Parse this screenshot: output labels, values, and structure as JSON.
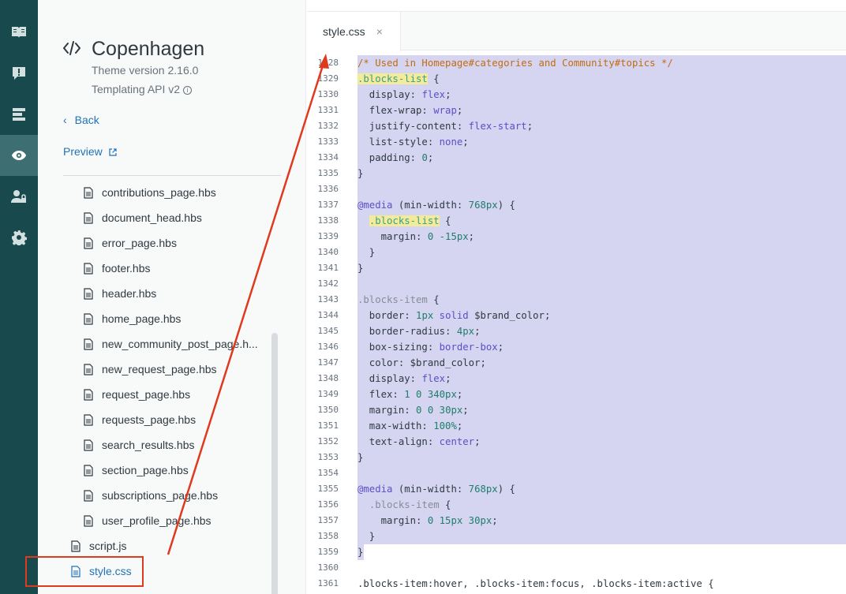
{
  "rail": {
    "items": [
      {
        "name": "guide-icon",
        "active": false
      },
      {
        "name": "alert-icon",
        "active": false
      },
      {
        "name": "layout-icon",
        "active": false
      },
      {
        "name": "eye-icon",
        "active": true
      },
      {
        "name": "user-lock-icon",
        "active": false
      },
      {
        "name": "gear-icon",
        "active": false
      }
    ]
  },
  "sidebar": {
    "theme_name": "Copenhagen",
    "theme_version": "Theme version 2.16.0",
    "api_version": "Templating API v2",
    "api_info": "i",
    "back_label": "Back",
    "preview_label": "Preview",
    "files": [
      {
        "label": "contributions_page.hbs",
        "level": "nested"
      },
      {
        "label": "document_head.hbs",
        "level": "nested"
      },
      {
        "label": "error_page.hbs",
        "level": "nested"
      },
      {
        "label": "footer.hbs",
        "level": "nested"
      },
      {
        "label": "header.hbs",
        "level": "nested"
      },
      {
        "label": "home_page.hbs",
        "level": "nested"
      },
      {
        "label": "new_community_post_page.h...",
        "level": "nested"
      },
      {
        "label": "new_request_page.hbs",
        "level": "nested"
      },
      {
        "label": "request_page.hbs",
        "level": "nested"
      },
      {
        "label": "requests_page.hbs",
        "level": "nested"
      },
      {
        "label": "search_results.hbs",
        "level": "nested"
      },
      {
        "label": "section_page.hbs",
        "level": "nested"
      },
      {
        "label": "subscriptions_page.hbs",
        "level": "nested"
      },
      {
        "label": "user_profile_page.hbs",
        "level": "nested"
      },
      {
        "label": "script.js",
        "level": "root"
      },
      {
        "label": "style.css",
        "level": "root",
        "selected": true
      }
    ]
  },
  "editor": {
    "tab_label": "style.css",
    "tab_close": "×",
    "lines": [
      {
        "n": "1328",
        "sel": true,
        "segs": [
          {
            "t": "/* Used in Homepage#categories and Community#topics */",
            "c": "c-com"
          }
        ]
      },
      {
        "n": "1329",
        "sel": true,
        "segs": [
          {
            "t": ".blocks-list",
            "c": "c-sel"
          },
          {
            "t": " {",
            "c": ""
          }
        ]
      },
      {
        "n": "1330",
        "sel": true,
        "segs": [
          {
            "t": "  display: ",
            "c": ""
          },
          {
            "t": "flex",
            "c": "c-kw"
          },
          {
            "t": ";",
            "c": ""
          }
        ]
      },
      {
        "n": "1331",
        "sel": true,
        "segs": [
          {
            "t": "  flex-wrap: ",
            "c": ""
          },
          {
            "t": "wrap",
            "c": "c-kw"
          },
          {
            "t": ";",
            "c": ""
          }
        ]
      },
      {
        "n": "1332",
        "sel": true,
        "segs": [
          {
            "t": "  justify-content: ",
            "c": ""
          },
          {
            "t": "flex-start",
            "c": "c-kw"
          },
          {
            "t": ";",
            "c": ""
          }
        ]
      },
      {
        "n": "1333",
        "sel": true,
        "segs": [
          {
            "t": "  list-style: ",
            "c": ""
          },
          {
            "t": "none",
            "c": "c-kw"
          },
          {
            "t": ";",
            "c": ""
          }
        ]
      },
      {
        "n": "1334",
        "sel": true,
        "segs": [
          {
            "t": "  padding: ",
            "c": ""
          },
          {
            "t": "0",
            "c": "c-num"
          },
          {
            "t": ";",
            "c": ""
          }
        ]
      },
      {
        "n": "1335",
        "sel": true,
        "segs": [
          {
            "t": "}",
            "c": ""
          }
        ]
      },
      {
        "n": "1336",
        "sel": true,
        "segs": [
          {
            "t": "",
            "c": ""
          }
        ]
      },
      {
        "n": "1337",
        "sel": true,
        "segs": [
          {
            "t": "@media",
            "c": "c-at"
          },
          {
            "t": " (min-width: ",
            "c": ""
          },
          {
            "t": "768px",
            "c": "c-num"
          },
          {
            "t": ") {",
            "c": ""
          }
        ]
      },
      {
        "n": "1338",
        "sel": true,
        "segs": [
          {
            "t": "  ",
            "c": ""
          },
          {
            "t": ".blocks-list",
            "c": "c-sel"
          },
          {
            "t": " {",
            "c": ""
          }
        ]
      },
      {
        "n": "1339",
        "sel": true,
        "segs": [
          {
            "t": "    margin: ",
            "c": ""
          },
          {
            "t": "0 -15px",
            "c": "c-num"
          },
          {
            "t": ";",
            "c": ""
          }
        ]
      },
      {
        "n": "1340",
        "sel": true,
        "segs": [
          {
            "t": "  }",
            "c": ""
          }
        ]
      },
      {
        "n": "1341",
        "sel": true,
        "segs": [
          {
            "t": "}",
            "c": ""
          }
        ]
      },
      {
        "n": "1342",
        "sel": true,
        "segs": [
          {
            "t": "",
            "c": ""
          }
        ]
      },
      {
        "n": "1343",
        "sel": true,
        "segs": [
          {
            "t": ".blocks-item",
            "c": "c-selplain"
          },
          {
            "t": " {",
            "c": ""
          }
        ]
      },
      {
        "n": "1344",
        "sel": true,
        "segs": [
          {
            "t": "  border: ",
            "c": ""
          },
          {
            "t": "1px",
            "c": "c-num"
          },
          {
            "t": " ",
            "c": ""
          },
          {
            "t": "solid",
            "c": "c-kw"
          },
          {
            "t": " $brand_color;",
            "c": ""
          }
        ]
      },
      {
        "n": "1345",
        "sel": true,
        "segs": [
          {
            "t": "  border-radius: ",
            "c": ""
          },
          {
            "t": "4px",
            "c": "c-num"
          },
          {
            "t": ";",
            "c": ""
          }
        ]
      },
      {
        "n": "1346",
        "sel": true,
        "segs": [
          {
            "t": "  box-sizing: ",
            "c": ""
          },
          {
            "t": "border-box",
            "c": "c-kw"
          },
          {
            "t": ";",
            "c": ""
          }
        ]
      },
      {
        "n": "1347",
        "sel": true,
        "segs": [
          {
            "t": "  color: $brand_color;",
            "c": ""
          }
        ]
      },
      {
        "n": "1348",
        "sel": true,
        "segs": [
          {
            "t": "  display: ",
            "c": ""
          },
          {
            "t": "flex",
            "c": "c-kw"
          },
          {
            "t": ";",
            "c": ""
          }
        ]
      },
      {
        "n": "1349",
        "sel": true,
        "segs": [
          {
            "t": "  flex: ",
            "c": ""
          },
          {
            "t": "1 0 340px",
            "c": "c-num"
          },
          {
            "t": ";",
            "c": ""
          }
        ]
      },
      {
        "n": "1350",
        "sel": true,
        "segs": [
          {
            "t": "  margin: ",
            "c": ""
          },
          {
            "t": "0 0 30px",
            "c": "c-num"
          },
          {
            "t": ";",
            "c": ""
          }
        ]
      },
      {
        "n": "1351",
        "sel": true,
        "segs": [
          {
            "t": "  max-width: ",
            "c": ""
          },
          {
            "t": "100%",
            "c": "c-num"
          },
          {
            "t": ";",
            "c": ""
          }
        ]
      },
      {
        "n": "1352",
        "sel": true,
        "segs": [
          {
            "t": "  text-align: ",
            "c": ""
          },
          {
            "t": "center",
            "c": "c-kw"
          },
          {
            "t": ";",
            "c": ""
          }
        ]
      },
      {
        "n": "1353",
        "sel": true,
        "segs": [
          {
            "t": "}",
            "c": ""
          }
        ]
      },
      {
        "n": "1354",
        "sel": true,
        "segs": [
          {
            "t": "",
            "c": ""
          }
        ]
      },
      {
        "n": "1355",
        "sel": true,
        "segs": [
          {
            "t": "@media",
            "c": "c-at"
          },
          {
            "t": " (min-width: ",
            "c": ""
          },
          {
            "t": "768px",
            "c": "c-num"
          },
          {
            "t": ") {",
            "c": ""
          }
        ]
      },
      {
        "n": "1356",
        "sel": true,
        "segs": [
          {
            "t": "  ",
            "c": ""
          },
          {
            "t": ".blocks-item",
            "c": "c-selplain"
          },
          {
            "t": " {",
            "c": ""
          }
        ]
      },
      {
        "n": "1357",
        "sel": true,
        "segs": [
          {
            "t": "    margin: ",
            "c": ""
          },
          {
            "t": "0 15px 30px",
            "c": "c-num"
          },
          {
            "t": ";",
            "c": ""
          }
        ]
      },
      {
        "n": "1358",
        "sel": true,
        "segs": [
          {
            "t": "  }",
            "c": ""
          }
        ]
      },
      {
        "n": "1359",
        "sel": "part",
        "segs": [
          {
            "t": "}",
            "c": ""
          }
        ]
      },
      {
        "n": "1360",
        "sel": false,
        "segs": [
          {
            "t": "",
            "c": ""
          }
        ]
      },
      {
        "n": "1361",
        "sel": false,
        "segs": [
          {
            "t": ".blocks-item:hover, .blocks-item:focus, .blocks-item:active {",
            "c": ""
          }
        ]
      }
    ]
  },
  "colors": {
    "rail_bg": "#17494d",
    "rail_active": "#3d6e72",
    "link": "#1f73b7",
    "selection": "#d5d5f1",
    "annotation": "#e03a1e"
  }
}
